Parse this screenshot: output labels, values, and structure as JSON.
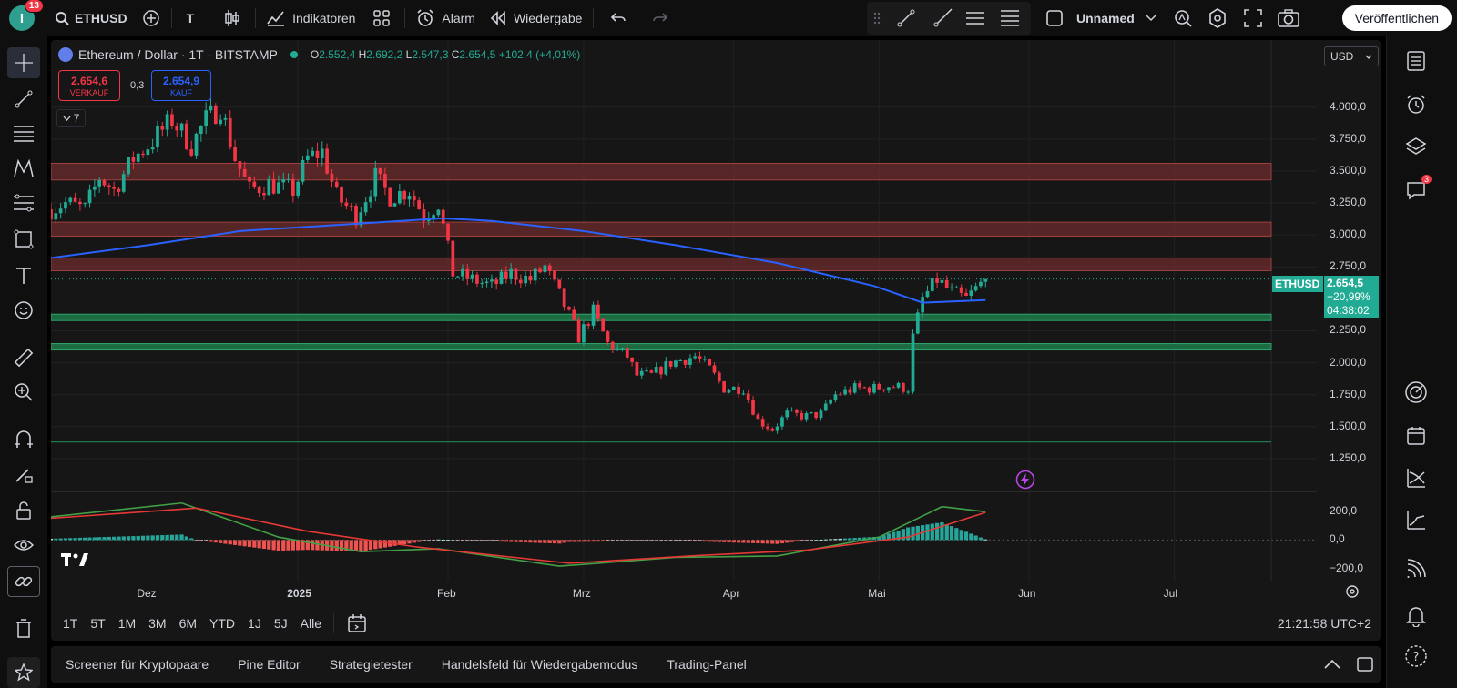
{
  "topbar": {
    "avatar_initial": "I",
    "notifications": "13",
    "symbol": "ETHUSD",
    "timeframe_letter": "T",
    "indicators_label": "Indikatoren",
    "alarm_label": "Alarm",
    "replay_label": "Wiedergabe",
    "layout_name": "Unnamed",
    "publish_label": "Veröffentlichen"
  },
  "legend": {
    "title": "Ethereum / Dollar · 1T · BITSTAMP",
    "o_key": "O",
    "o_val": "2.552,4",
    "h_key": "H",
    "h_val": "2.692,2",
    "l_key": "L",
    "l_val": "2.547,3",
    "c_key": "C",
    "c_val": "2.654,5",
    "change": "+102,4 (+4,01%)",
    "sell_price": "2.654,6",
    "sell_label": "VERKAUF",
    "spread": "0,3",
    "buy_price": "2.654,9",
    "buy_label": "KAUF",
    "indicators_count": "7"
  },
  "currency_select": "USD",
  "price_tag": {
    "symbol": "ETHUSD",
    "price": "2.654,5",
    "change": "−20,99%",
    "countdown": "04:38:02"
  },
  "colors": {
    "up": "#22ab94",
    "down": "#f23645",
    "ma": "#2962ff",
    "macd": "#43a047",
    "signal": "#e53935",
    "resistance": "#7a2e2e",
    "support": "#1e7a4a"
  },
  "range_buttons": [
    "1T",
    "5T",
    "1M",
    "3M",
    "6M",
    "YTD",
    "1J",
    "5J",
    "Alle"
  ],
  "clock": "21:21:58 UTC+2",
  "bottom_tabs": [
    "Screener für Kryptopaare",
    "Pine Editor",
    "Strategietester",
    "Handelsfeld für Wiedergabemodus",
    "Trading-Panel"
  ],
  "chart_data": {
    "type": "candlestick",
    "symbol": "ETHUSD",
    "y_ticks": [
      "4.000,0",
      "3.750,0",
      "3.500,0",
      "3.250,0",
      "3.000,0",
      "2.750,0",
      "2.250,0",
      "2.000,0",
      "1.750,0",
      "1.500,0",
      "1.250,0"
    ],
    "y_tick_values": [
      4000,
      3750,
      3500,
      3250,
      3000,
      2750,
      2250,
      2000,
      1750,
      1500,
      1250
    ],
    "ylim": [
      1050,
      4240
    ],
    "x_ticks": [
      "Dez",
      "2025",
      "Feb",
      "Mrz",
      "Apr",
      "Mai",
      "Jun",
      "Jul"
    ],
    "x_tick_dates": [
      "2024-12-01",
      "2025-01-01",
      "2025-02-01",
      "2025-03-01",
      "2025-04-01",
      "2025-05-01",
      "2025-06-01",
      "2025-07-01"
    ],
    "xlim": [
      "2024-11-11",
      "2025-07-21"
    ],
    "close_path": [
      [
        "2024-11-11",
        3200
      ],
      [
        "2024-11-14",
        3250
      ],
      [
        "2024-11-18",
        3200
      ],
      [
        "2024-11-21",
        3450
      ],
      [
        "2024-11-24",
        3350
      ],
      [
        "2024-11-28",
        3600
      ],
      [
        "2024-12-01",
        3700
      ],
      [
        "2024-12-06",
        3900
      ],
      [
        "2024-12-10",
        3700
      ],
      [
        "2024-12-13",
        3900
      ],
      [
        "2024-12-16",
        4000
      ],
      [
        "2024-12-19",
        3600
      ],
      [
        "2024-12-22",
        3350
      ],
      [
        "2024-12-26",
        3400
      ],
      [
        "2024-12-31",
        3350
      ],
      [
        "2025-01-03",
        3600
      ],
      [
        "2025-01-06",
        3650
      ],
      [
        "2025-01-09",
        3300
      ],
      [
        "2025-01-13",
        3150
      ],
      [
        "2025-01-17",
        3450
      ],
      [
        "2025-01-20",
        3300
      ],
      [
        "2025-01-24",
        3350
      ],
      [
        "2025-01-27",
        3150
      ],
      [
        "2025-01-30",
        3250
      ],
      [
        "2025-02-02",
        2700
      ],
      [
        "2025-02-06",
        2650
      ],
      [
        "2025-02-10",
        2600
      ],
      [
        "2025-02-14",
        2700
      ],
      [
        "2025-02-18",
        2650
      ],
      [
        "2025-02-21",
        2750
      ],
      [
        "2025-02-25",
        2450
      ],
      [
        "2025-02-28",
        2200
      ],
      [
        "2025-03-03",
        2400
      ],
      [
        "2025-03-06",
        2150
      ],
      [
        "2025-03-10",
        2050
      ],
      [
        "2025-03-12",
        1900
      ],
      [
        "2025-03-15",
        1900
      ],
      [
        "2025-03-19",
        2000
      ],
      [
        "2025-03-24",
        2050
      ],
      [
        "2025-03-27",
        1950
      ],
      [
        "2025-03-30",
        1800
      ],
      [
        "2025-04-03",
        1800
      ],
      [
        "2025-04-06",
        1550
      ],
      [
        "2025-04-09",
        1480
      ],
      [
        "2025-04-12",
        1600
      ],
      [
        "2025-04-16",
        1580
      ],
      [
        "2025-04-19",
        1600
      ],
      [
        "2025-04-22",
        1750
      ],
      [
        "2025-04-26",
        1800
      ],
      [
        "2025-04-30",
        1800
      ],
      [
        "2025-05-03",
        1820
      ],
      [
        "2025-05-07",
        1800
      ],
      [
        "2025-05-08",
        2200
      ],
      [
        "2025-05-10",
        2500
      ],
      [
        "2025-05-13",
        2650
      ],
      [
        "2025-05-16",
        2550
      ],
      [
        "2025-05-19",
        2500
      ],
      [
        "2025-05-23",
        2654.5
      ]
    ],
    "ma_path": [
      [
        "2024-11-11",
        2820
      ],
      [
        "2024-12-01",
        2920
      ],
      [
        "2024-12-20",
        3030
      ],
      [
        "2025-01-10",
        3080
      ],
      [
        "2025-01-31",
        3130
      ],
      [
        "2025-02-10",
        3110
      ],
      [
        "2025-03-01",
        3030
      ],
      [
        "2025-03-20",
        2920
      ],
      [
        "2025-04-10",
        2780
      ],
      [
        "2025-04-30",
        2600
      ],
      [
        "2025-05-10",
        2470
      ],
      [
        "2025-05-23",
        2490
      ]
    ],
    "resistance_zones": [
      [
        3430,
        3560
      ],
      [
        2990,
        3100
      ],
      [
        2720,
        2820
      ]
    ],
    "support_zones": [
      [
        2330,
        2380
      ],
      [
        2100,
        2150
      ]
    ],
    "horizontal_line": 1380,
    "indicator": {
      "y_ticks": [
        "200,0",
        "0,0",
        "−200,0"
      ],
      "y_tick_values": [
        200,
        0,
        -200
      ],
      "ylim": [
        -280,
        310
      ],
      "macd": [
        [
          "2024-11-11",
          160
        ],
        [
          "2024-12-08",
          255
        ],
        [
          "2024-12-28",
          20
        ],
        [
          "2025-01-14",
          -80
        ],
        [
          "2025-01-30",
          -60
        ],
        [
          "2025-02-24",
          -180
        ],
        [
          "2025-03-20",
          -120
        ],
        [
          "2025-04-10",
          -110
        ],
        [
          "2025-05-01",
          20
        ],
        [
          "2025-05-14",
          230
        ],
        [
          "2025-05-23",
          195
        ]
      ],
      "signal": [
        [
          "2024-11-11",
          150
        ],
        [
          "2024-12-11",
          220
        ],
        [
          "2025-01-03",
          60
        ],
        [
          "2025-01-26",
          -50
        ],
        [
          "2025-02-26",
          -160
        ],
        [
          "2025-03-23",
          -110
        ],
        [
          "2025-04-16",
          -70
        ],
        [
          "2025-05-07",
          20
        ],
        [
          "2025-05-23",
          190
        ]
      ]
    }
  }
}
